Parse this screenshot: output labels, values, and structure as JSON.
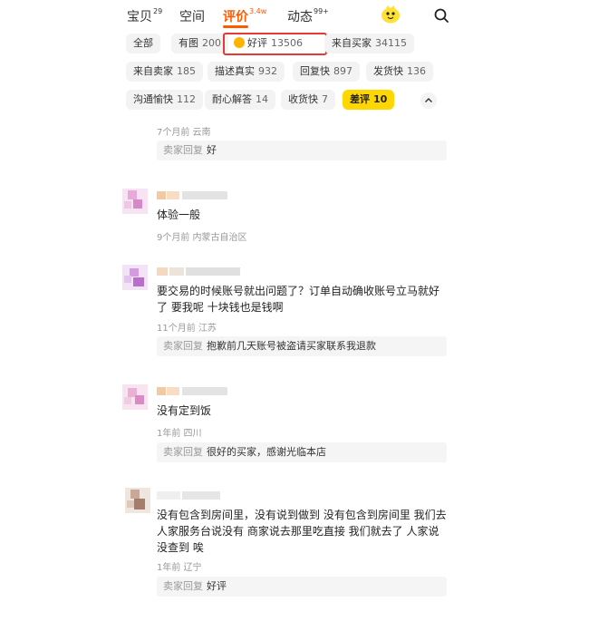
{
  "tabs": [
    {
      "label": "宝贝",
      "badge": "29"
    },
    {
      "label": "空间",
      "badge": ""
    },
    {
      "label": "评价",
      "badge": "3.4w"
    },
    {
      "label": "动态",
      "badge": "99+"
    }
  ],
  "filters": [
    {
      "label": "全部",
      "count": ""
    },
    {
      "label": "有图",
      "count": "200"
    },
    {
      "label": "好评",
      "count": "13506"
    },
    {
      "label": "来自买家",
      "count": "34115"
    },
    {
      "label": "来自卖家",
      "count": "185"
    },
    {
      "label": "描述真实",
      "count": "932"
    },
    {
      "label": "回复快",
      "count": "897"
    },
    {
      "label": "发货快",
      "count": "136"
    },
    {
      "label": "沟通愉快",
      "count": "112"
    },
    {
      "label": "耐心解答",
      "count": "14"
    },
    {
      "label": "收货快",
      "count": "7"
    },
    {
      "label": "差评",
      "count": "10"
    }
  ],
  "reply_label": "卖家回复",
  "reviews": [
    {
      "text": "",
      "meta": "7个月前 云南",
      "reply": "好"
    },
    {
      "text": "体验一般",
      "meta": "9个月前 内蒙古自治区",
      "reply": ""
    },
    {
      "text": "要交易的时候账号就出问题了？订单自动确收账号立马就好了 要我呢 十块钱也是钱啊",
      "meta": "11个月前 江苏",
      "reply": "抱歉前几天账号被盗请买家联系我退款"
    },
    {
      "text": "没有定到饭",
      "meta": "1年前 四川",
      "reply": "很好的买家，感谢光临本店"
    },
    {
      "text": "没有包含到房间里，没有说到做到 没有包含到房间里 我们去人家服务台说没有 商家说去那里吃直接 我们就去了 人家说没查到 唉",
      "meta": "1年前 辽宁",
      "reply": "好评"
    }
  ]
}
